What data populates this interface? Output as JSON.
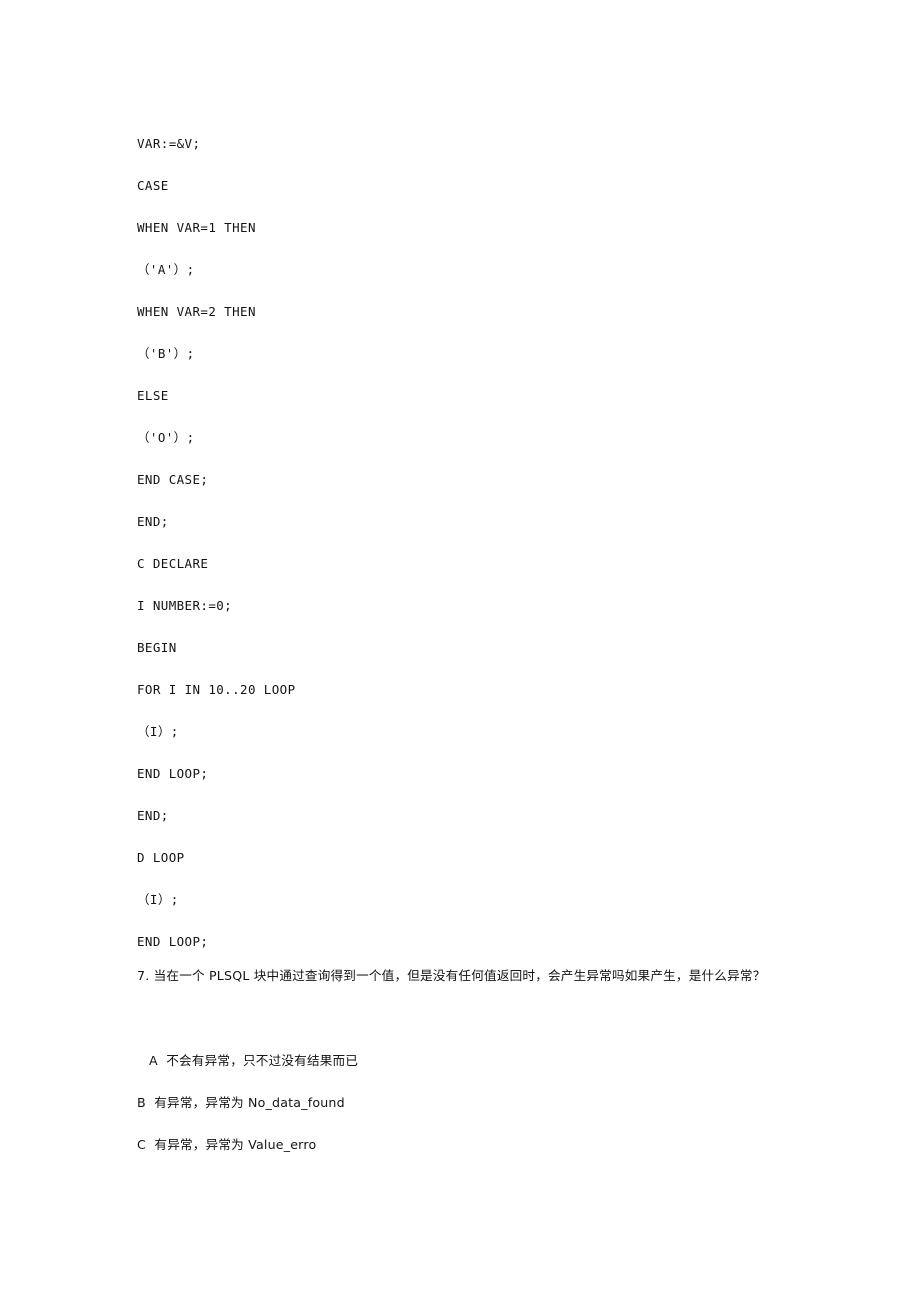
{
  "document": {
    "background_color": "#ffffff",
    "text_color": "#141414",
    "code_block": {
      "lines": [
        {
          "text": "VAR:=&V;"
        },
        {
          "text": "CASE"
        },
        {
          "text": "WHEN VAR=1 THEN"
        },
        {
          "text": "（'A'）;"
        },
        {
          "text": "WHEN VAR=2 THEN"
        },
        {
          "text": "（'B'）;"
        },
        {
          "text": "ELSE"
        },
        {
          "text": "（'O'）;"
        },
        {
          "text": "END CASE;"
        },
        {
          "text": "END;"
        },
        {
          "text": "C DECLARE"
        },
        {
          "text": "I NUMBER:=0;"
        },
        {
          "text": "BEGIN"
        },
        {
          "text": "FOR I IN 10..20 LOOP"
        },
        {
          "text": "（I）;"
        },
        {
          "text": "END LOOP;"
        },
        {
          "text": "END;"
        },
        {
          "text": "D LOOP"
        },
        {
          "text": "（I）;"
        },
        {
          "text": "END LOOP;"
        }
      ]
    },
    "question": {
      "number": "7.",
      "text": "7.  当在一个 PLSQL 块中通过查询得到一个值，但是没有任何值返回时，会产生异常吗如果产生，是什么异常？",
      "options": [
        {
          "label": "A",
          "text": "A  不会有异常，只不过没有结果而已",
          "indented": true
        },
        {
          "label": "B",
          "text": "B  有异常，异常为 No_data_found",
          "indented": false
        },
        {
          "label": "C",
          "text": "C  有异常，异常为 Value_erro",
          "indented": false
        }
      ]
    }
  }
}
